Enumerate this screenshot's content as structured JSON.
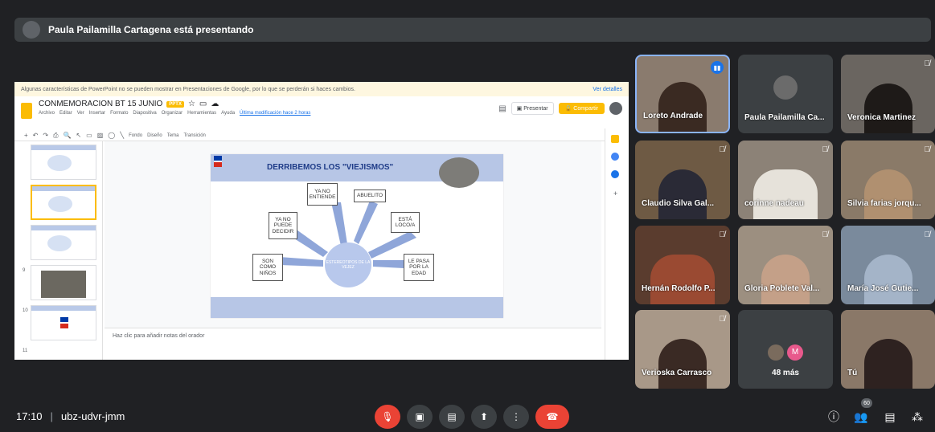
{
  "banner": {
    "text": "Paula Pailamilla Cartagena está presentando"
  },
  "screen": {
    "warning": "Algunas características de PowerPoint no se pueden mostrar en Presentaciones de Google, por lo que se perderán si haces cambios.",
    "warning_link": "Ver detalles",
    "doc_title": "CONMEMORACION BT 15 JUNIO",
    "badge": "PPTX",
    "menu": [
      "Archivo",
      "Editar",
      "Ver",
      "Insertar",
      "Formato",
      "Diapositiva",
      "Organizar",
      "Herramientas",
      "Ayuda"
    ],
    "last_edit": "Última modificación hace 2 horas",
    "present_label": "Presentar",
    "share_label": "Compartir",
    "toolbar_items": [
      "Fondo",
      "Diseño",
      "Tema",
      "Transición"
    ],
    "thumb_numbers": [
      "9",
      "10",
      "11"
    ],
    "notes_placeholder": "Haz clic para añadir notas del orador",
    "slide": {
      "title": "DERRIBEMOS LOS \"VIEJISMOS\"",
      "center": "ESTEREOTIPOS DE LA VEJEZ",
      "boxes": {
        "ya_no_entiende": "YA NO ENTIENDE",
        "abuelito": "ABUELITO",
        "ya_no_puede": "YA NO PUEDE DECIDIR",
        "esta_loco": "ESTÁ LOCO/A",
        "son_como": "SON COMO NIÑOS",
        "le_pasa": "LE PASA POR LA EDAD"
      }
    }
  },
  "participants": [
    {
      "name": "Loreto Andrade"
    },
    {
      "name": "Paula Pailamilla Ca..."
    },
    {
      "name": "Veronica Martinez"
    },
    {
      "name": "Claudio Silva Gal..."
    },
    {
      "name": "corinne nadeau"
    },
    {
      "name": "Silvia farias jorqu..."
    },
    {
      "name": "Hernán Rodolfo P..."
    },
    {
      "name": "Gloria Poblete Val..."
    },
    {
      "name": "María José Gutie..."
    },
    {
      "name": "Verioska Carrasco"
    },
    {
      "name": "Tú"
    }
  ],
  "more_tile": {
    "avatar_letter": "M",
    "count_label": "48 más"
  },
  "meeting": {
    "time": "17:10",
    "separator": "|",
    "code": "ubz-udvr-jmm"
  },
  "people_count": "60",
  "colors": {
    "background": "#202124",
    "tile": "#3c4043",
    "danger": "#ea4335",
    "accent": "#8ab4f8"
  }
}
